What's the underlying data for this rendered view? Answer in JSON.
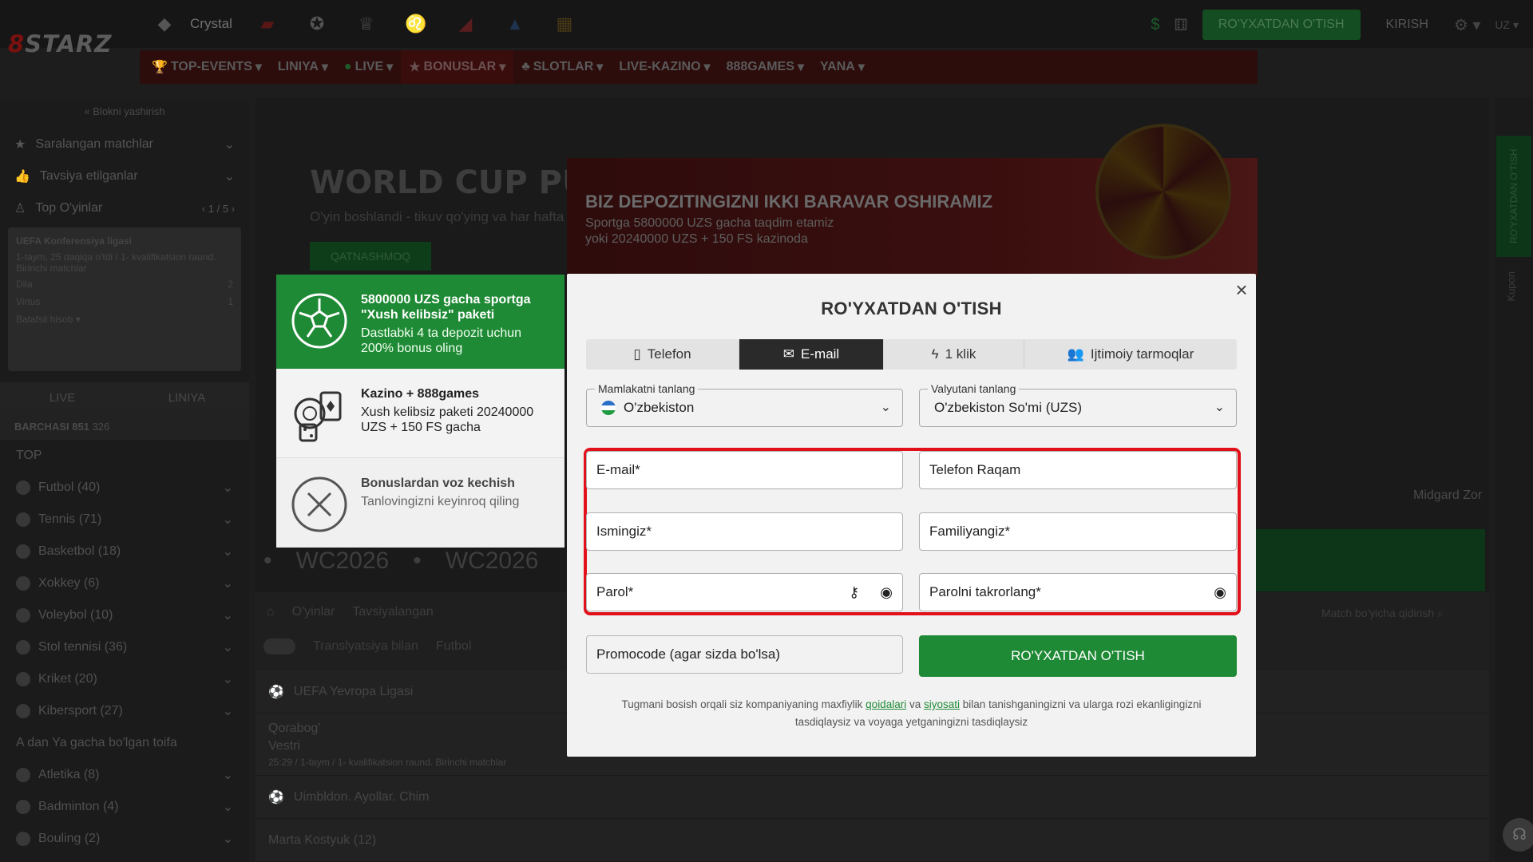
{
  "header": {
    "logo_prefix": "8",
    "logo": "STARZ",
    "crystal": "Crystal",
    "register": "RO'YXATDAN O'TISH",
    "login": "KIRISH",
    "lang": "UZ"
  },
  "nav": {
    "items": [
      "TOP-EVENTS",
      "LINIYA",
      "LIVE",
      "BONUSLAR",
      "SLOTLAR",
      "LIVE-KAZINO",
      "888GAMES",
      "YANA"
    ]
  },
  "sidebar": {
    "hide": "« Blokni yashirish",
    "rows": [
      "Saralangan matchlar",
      "Tavsiya etilganlar",
      "Top O'yinlar"
    ],
    "top_pager": "1 / 5",
    "match": {
      "league": "UEFA Konferensiya ligasi",
      "info": "1-taym, 25 daqiqa o'tdi / 1- kvalifikatsion raund. Birinchi matchlar",
      "team1": "Dila",
      "team2": "Virtus",
      "score1": "2",
      "score2": "1",
      "more": "Batafsil hisob"
    },
    "tabs": [
      "LIVE",
      "LINIYA"
    ],
    "all_label": "BARCHASI 851",
    "all_count": "326",
    "top_label": "TOP",
    "sports": [
      "Futbol (40)",
      "Tennis (71)",
      "Basketbol (18)",
      "Xokkey (6)",
      "Voleybol (10)",
      "Stol tennisi (36)",
      "Kriket (20)",
      "Kibersport (27)"
    ],
    "category": "A dan Ya gacha bo'lgan toifa",
    "sports2": [
      "Atletika (8)",
      "Badminton (4)",
      "Bouling (2)"
    ]
  },
  "banner": {
    "title": "WORLD CUP PUL",
    "sub": "O'yin boshlandi - tikuv qo'ying va har hafta k",
    "button": "QATNASHMOQ",
    "promo_title": "BIZ DEPOZITINGIZNI IKKI BARAVAR OSHIRAMIZ",
    "promo_l1": "Sportga 5800000 UZS gacha taqdim etamiz",
    "promo_l2": "yoki 20240000 UZS + 150 FS kazinoda",
    "wc": "WC2026",
    "midgard": "Midgard Zor"
  },
  "main": {
    "crumbs": [
      "O'yinlar",
      "Tavsiyalangan"
    ],
    "filter1": "Translyatsiya bilan",
    "filter2": "Futbol",
    "search": "Match bo'yicha qidirish",
    "league": "UEFA Yevropa Ligasi",
    "team1": "Qorabog'",
    "team2": "Vestri",
    "row_info": "25:29 / 1-taym / 1- kvalifikatsion raund. Birinchi matchlar",
    "row2": "Uimbldon. Ayollar. Chim",
    "row3": "Marta Kostyuk (12)"
  },
  "right": {
    "register": "RO'YXATDAN O'TISH",
    "kupon": "Kupon"
  },
  "bonus": {
    "items": [
      {
        "title": "5800000 UZS gacha sportga \"Xush kelibsiz\" paketi",
        "desc": "Dastlabki 4 ta depozit uchun 200% bonus oling"
      },
      {
        "title": "Kazino + 888games",
        "desc": "Xush kelibsiz paketi 20240000 UZS + 150 FS gacha"
      },
      {
        "title": "Bonuslardan voz kechish",
        "desc": "Tanlovingizni keyinroq qiling"
      }
    ]
  },
  "modal": {
    "title": "RO'YXATDAN O'TISH",
    "tabs": [
      "Telefon",
      "E-mail",
      "1 klik",
      "Ijtimoiy tarmoqlar"
    ],
    "country_label": "Mamlakatni tanlang",
    "country": "O'zbekiston",
    "currency_label": "Valyutani tanlang",
    "currency": "O'zbekiston So'mi (UZS)",
    "email": "E-mail*",
    "phone": "Telefon Raqam",
    "name": "Ismingiz*",
    "surname": "Familiyangiz*",
    "password": "Parol*",
    "password2": "Parolni takrorlang*",
    "promocode": "Promocode (agar sizda bo'lsa)",
    "submit": "RO'YXATDAN O'TISH",
    "terms_a": "Tugmani bosish orqali siz kompaniyaning maxfiylik",
    "terms_link1": "qoidalari",
    "terms_b": "va",
    "terms_link2": "siyosati",
    "terms_c": "bilan tanishganingizni va ularga rozi ekanligingizni tasdiqlaysiz va voyaga yetganingizni tasdiqlaysiz"
  },
  "colors": {
    "accent": "#1f8a35",
    "highlight": "#e1101a",
    "dark": "#1d1d1d"
  }
}
